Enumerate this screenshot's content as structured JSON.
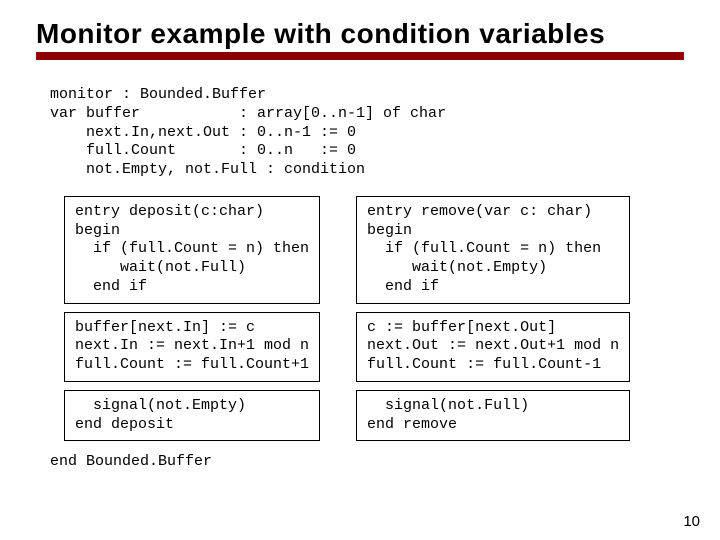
{
  "title": "Monitor example with condition variables",
  "decl": "monitor : Bounded.Buffer\nvar buffer           : array[0..n-1] of char\n    next.In,next.Out : 0..n-1 := 0\n    full.Count       : 0..n   := 0\n    not.Empty, not.Full : condition",
  "left": {
    "b1": "entry deposit(c:char)\nbegin\n  if (full.Count = n) then\n     wait(not.Full)\n  end if",
    "b2": "buffer[next.In] := c\nnext.In := next.In+1 mod n\nfull.Count := full.Count+1",
    "b3": "  signal(not.Empty)\nend deposit"
  },
  "right": {
    "b1": "entry remove(var c: char)\nbegin\n  if (full.Count = n) then\n     wait(not.Empty)\n  end if",
    "b2": "c := buffer[next.Out]\nnext.Out := next.Out+1 mod n\nfull.Count := full.Count-1",
    "b3": "  signal(not.Full)\nend remove"
  },
  "footer": "end Bounded.Buffer",
  "page": "10"
}
